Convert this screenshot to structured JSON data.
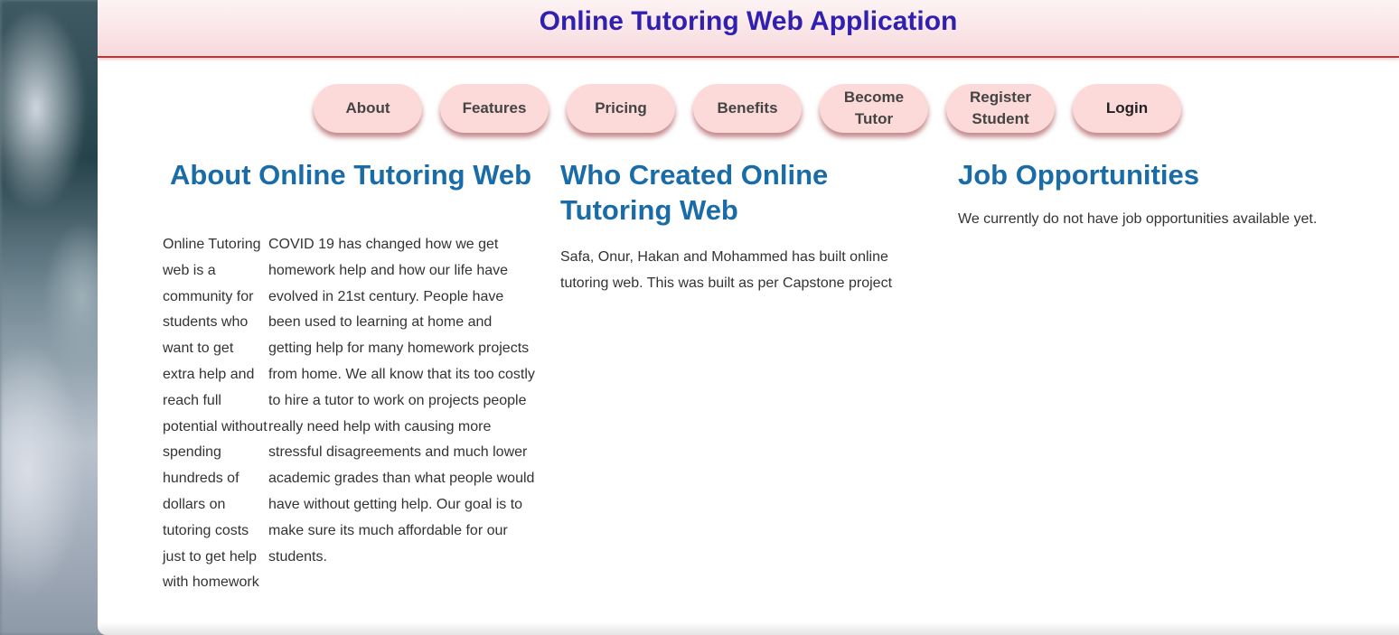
{
  "header": {
    "title": "Online Tutoring Web Application"
  },
  "nav": {
    "about": "About",
    "features": "Features",
    "pricing": "Pricing",
    "benefits": "Benefits",
    "become_tutor_1": "Become",
    "become_tutor_2": "Tutor",
    "register_student_1": "Register",
    "register_student_2": "Student",
    "login": "Login"
  },
  "about": {
    "heading": "About Online Tutoring Web",
    "para1": "Online Tutoring web is a community for students who want to get extra help and reach full potential without spending hundreds of dollars on tutoring costs just to get help with homework",
    "para2": "COVID 19 has changed how we get homework help and how our life have evolved in 21st century. People have been used to learning at home and getting help for many homework projects from home. We all know that its too costly to hire a tutor to work on projects people really need help with causing more stressful disagreements and much lower academic grades than what people would have without getting help. Our goal is to make sure its much affordable for our students."
  },
  "creators": {
    "heading": "Who Created Online Tutoring Web",
    "text": "Safa, Onur, Hakan and Mohammed has built online tutoring web. This was built as per Capstone project"
  },
  "jobs": {
    "heading": "Job Opportunities",
    "text": "We currently do not have job opportunities available yet."
  },
  "colors": {
    "title": "#3020b0",
    "heading": "#1a6ca8",
    "nav_button": "#fcdada",
    "header_border": "#b03a3e"
  }
}
